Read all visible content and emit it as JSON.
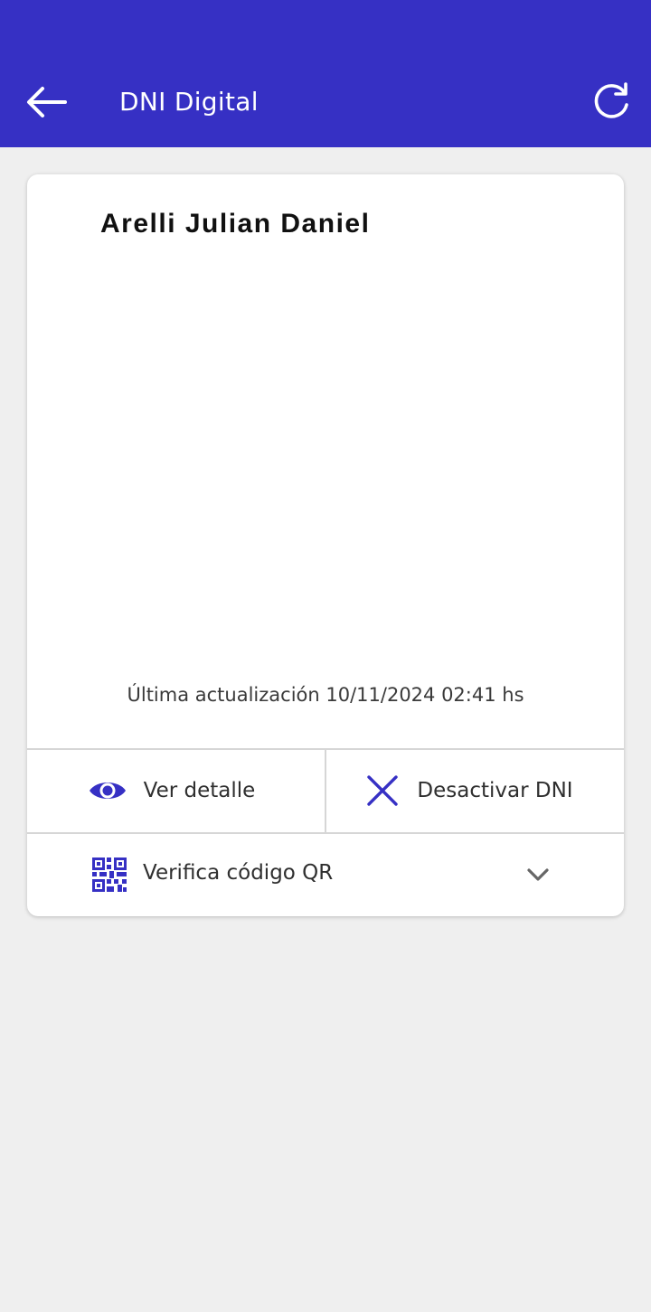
{
  "header": {
    "title": "DNI Digital",
    "back_icon": "arrow-left-icon",
    "refresh_icon": "refresh-icon",
    "background_color": "#3630c4"
  },
  "card": {
    "holder_name": "Arelli Julian Daniel",
    "last_update": "Última actualización 10/11/2024 02:41 hs"
  },
  "actions": {
    "view_detail_label": "Ver detalle",
    "view_detail_icon": "eye-icon",
    "deactivate_label": "Desactivar DNI",
    "deactivate_icon": "close-icon"
  },
  "qr": {
    "label": "Verifica código QR",
    "icon": "qr-code-icon",
    "expand_icon": "chevron-down-icon"
  },
  "colors": {
    "accent": "#3630c4",
    "background": "#efefef",
    "card": "#ffffff"
  }
}
